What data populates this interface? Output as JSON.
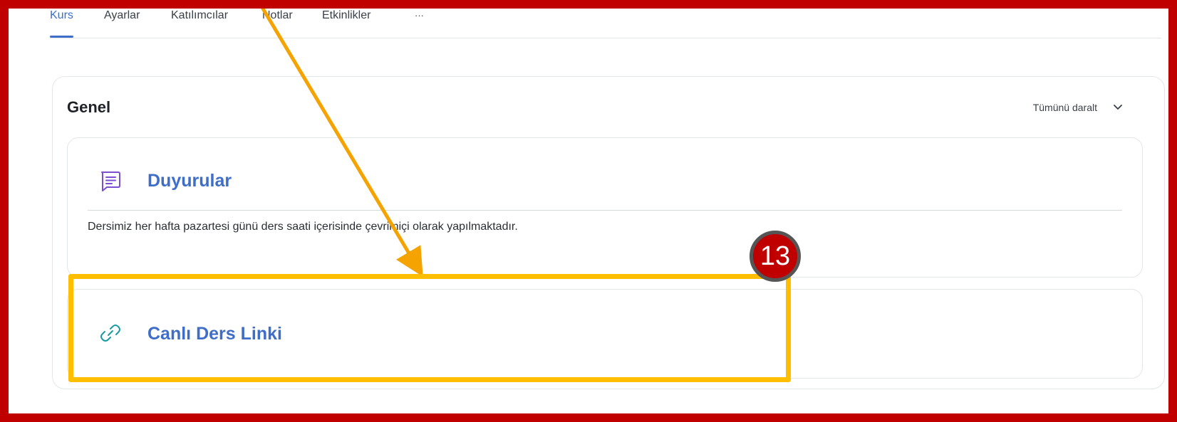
{
  "tabs": [
    {
      "label": "Kurs",
      "active": true
    },
    {
      "label": "Ayarlar"
    },
    {
      "label": "Katılımcılar"
    },
    {
      "label": "Notlar"
    },
    {
      "label": "Etkinlikler"
    },
    {
      "label": "···"
    }
  ],
  "section": {
    "title": "Genel",
    "collapse_label": "Tümünü daralt"
  },
  "activities": [
    {
      "icon": "forum-icon",
      "title": "Duyurular",
      "description": "Dersimiz her hafta pazartesi günü ders saati içerisinde çevrimiçi olarak yapılmaktadır."
    },
    {
      "icon": "link-icon",
      "title": "Canlı Ders Linki"
    }
  ],
  "annotation": {
    "badge_number": "13",
    "frame_color": "#c00000",
    "highlight_color": "#ffbf00",
    "arrow_color": "#f4a300"
  },
  "colors": {
    "accent": "#3e6ec7",
    "forum_icon": "#7a4fd0",
    "link_icon": "#1c9aa3"
  }
}
